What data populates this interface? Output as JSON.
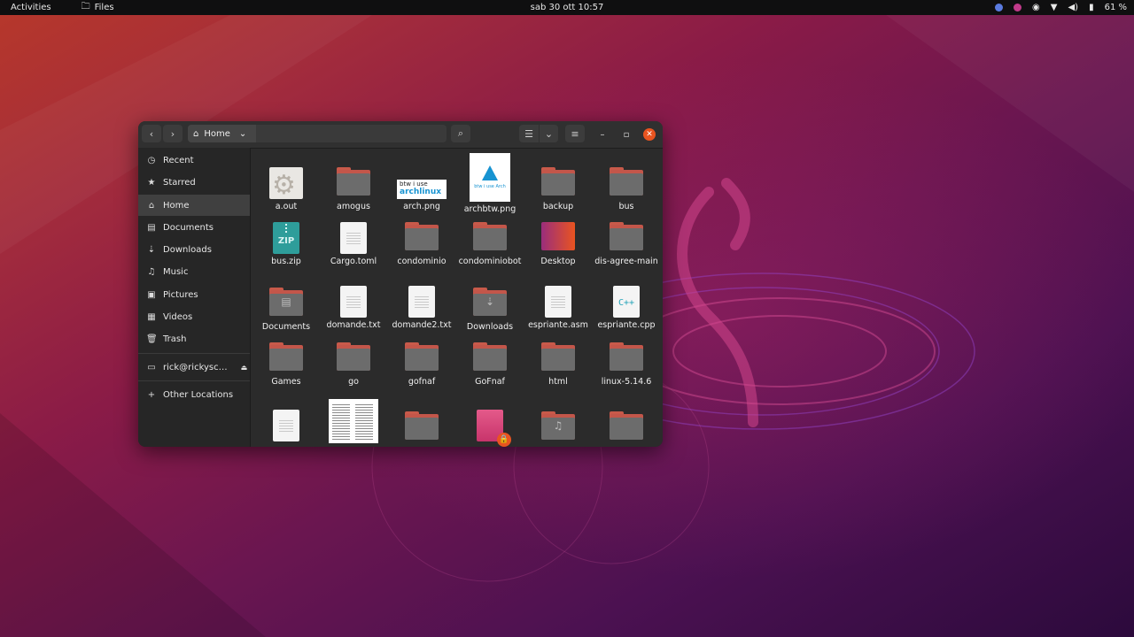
{
  "topbar": {
    "activities": "Activities",
    "app_name": "Files",
    "clock": "sab 30 ott  10:57",
    "battery": "61 %"
  },
  "window": {
    "path_label": "Home"
  },
  "sidebar": {
    "items": [
      {
        "label": "Recent",
        "icon": "clock-icon"
      },
      {
        "label": "Starred",
        "icon": "star-icon"
      },
      {
        "label": "Home",
        "icon": "home-icon"
      },
      {
        "label": "Documents",
        "icon": "documents-icon"
      },
      {
        "label": "Downloads",
        "icon": "download-icon"
      },
      {
        "label": "Music",
        "icon": "music-icon"
      },
      {
        "label": "Pictures",
        "icon": "pictures-icon"
      },
      {
        "label": "Videos",
        "icon": "videos-icon"
      },
      {
        "label": "Trash",
        "icon": "trash-icon"
      }
    ],
    "device": "rick@rickysc…",
    "other_locations": "Other Locations"
  },
  "files": [
    {
      "name": "a.out",
      "type": "binary"
    },
    {
      "name": "amogus",
      "type": "folder"
    },
    {
      "name": "arch.png",
      "type": "image-arch"
    },
    {
      "name": "archbtw.png",
      "type": "image-archbtw"
    },
    {
      "name": "backup",
      "type": "folder"
    },
    {
      "name": "bus",
      "type": "folder"
    },
    {
      "name": "bus.zip",
      "type": "zip"
    },
    {
      "name": "Cargo.toml",
      "type": "text"
    },
    {
      "name": "condominio",
      "type": "folder"
    },
    {
      "name": "condominiobot",
      "type": "folder"
    },
    {
      "name": "Desktop",
      "type": "desktop"
    },
    {
      "name": "dis-agree-main",
      "type": "folder"
    },
    {
      "name": "Documents",
      "type": "folder-documents"
    },
    {
      "name": "domande.txt",
      "type": "text"
    },
    {
      "name": "domande2.txt",
      "type": "text"
    },
    {
      "name": "Downloads",
      "type": "folder-downloads"
    },
    {
      "name": "espriante.asm",
      "type": "text"
    },
    {
      "name": "espriante.cpp",
      "type": "cpp"
    },
    {
      "name": "Games",
      "type": "folder"
    },
    {
      "name": "go",
      "type": "folder"
    },
    {
      "name": "gofnaf",
      "type": "folder"
    },
    {
      "name": "GoFnaf",
      "type": "folder"
    },
    {
      "name": "html",
      "type": "folder"
    },
    {
      "name": "linux-5.14.6",
      "type": "folder"
    }
  ],
  "arch_thumb": {
    "line1": "btw i use",
    "line2": "archlinux"
  },
  "archbtw_thumb": {
    "caption": "btw i use Arch"
  }
}
